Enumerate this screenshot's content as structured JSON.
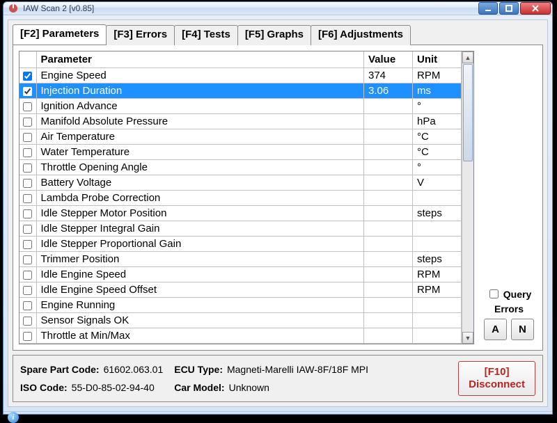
{
  "window": {
    "title": "IAW Scan 2 [v0.85]"
  },
  "tabs": [
    {
      "label": "[F2] Parameters",
      "active": true
    },
    {
      "label": "[F3] Errors"
    },
    {
      "label": "[F4] Tests"
    },
    {
      "label": "[F5] Graphs"
    },
    {
      "label": "[F6] Adjustments"
    }
  ],
  "table": {
    "headers": {
      "checkbox": "",
      "param": "Parameter",
      "value": "Value",
      "unit": "Unit"
    },
    "rows": [
      {
        "checked": true,
        "selected": false,
        "param": "Engine Speed",
        "value": "374",
        "unit": "RPM"
      },
      {
        "checked": true,
        "selected": true,
        "param": "Injection Duration",
        "value": "3.06",
        "unit": "ms"
      },
      {
        "checked": false,
        "selected": false,
        "param": "Ignition Advance",
        "value": "",
        "unit": "°"
      },
      {
        "checked": false,
        "selected": false,
        "param": "Manifold Absolute Pressure",
        "value": "",
        "unit": "hPa"
      },
      {
        "checked": false,
        "selected": false,
        "param": "Air Temperature",
        "value": "",
        "unit": "°C"
      },
      {
        "checked": false,
        "selected": false,
        "param": "Water Temperature",
        "value": "",
        "unit": "°C"
      },
      {
        "checked": false,
        "selected": false,
        "param": "Throttle Opening Angle",
        "value": "",
        "unit": "°"
      },
      {
        "checked": false,
        "selected": false,
        "param": "Battery Voltage",
        "value": "",
        "unit": "V"
      },
      {
        "checked": false,
        "selected": false,
        "param": "Lambda Probe Correction",
        "value": "",
        "unit": ""
      },
      {
        "checked": false,
        "selected": false,
        "param": "Idle Stepper Motor Position",
        "value": "",
        "unit": "steps"
      },
      {
        "checked": false,
        "selected": false,
        "param": "Idle Stepper Integral Gain",
        "value": "",
        "unit": ""
      },
      {
        "checked": false,
        "selected": false,
        "param": "Idle Stepper Proportional Gain",
        "value": "",
        "unit": ""
      },
      {
        "checked": false,
        "selected": false,
        "param": "Trimmer Position",
        "value": "",
        "unit": "steps"
      },
      {
        "checked": false,
        "selected": false,
        "param": "Idle Engine Speed",
        "value": "",
        "unit": "RPM"
      },
      {
        "checked": false,
        "selected": false,
        "param": "Idle Engine Speed Offset",
        "value": "",
        "unit": "RPM"
      },
      {
        "checked": false,
        "selected": false,
        "param": "Engine Running",
        "value": "",
        "unit": ""
      },
      {
        "checked": false,
        "selected": false,
        "param": "Sensor Signals OK",
        "value": "",
        "unit": ""
      },
      {
        "checked": false,
        "selected": false,
        "param": "Throttle at Min/Max",
        "value": "",
        "unit": ""
      }
    ]
  },
  "side": {
    "query_line1": "Query",
    "query_line2": "Errors",
    "btn_a": "A",
    "btn_n": "N"
  },
  "footer": {
    "spare_label": "Spare Part Code:",
    "spare_value": "61602.063.01",
    "ecu_label": "ECU Type:",
    "ecu_value": "Magneti-Marelli IAW-8F/18F MPI",
    "iso_label": "ISO Code:",
    "iso_value": "55-D0-85-02-94-40",
    "model_label": "Car Model:",
    "model_value": "Unknown",
    "disconnect_line1": "[F10]",
    "disconnect_line2": "Disconnect"
  }
}
